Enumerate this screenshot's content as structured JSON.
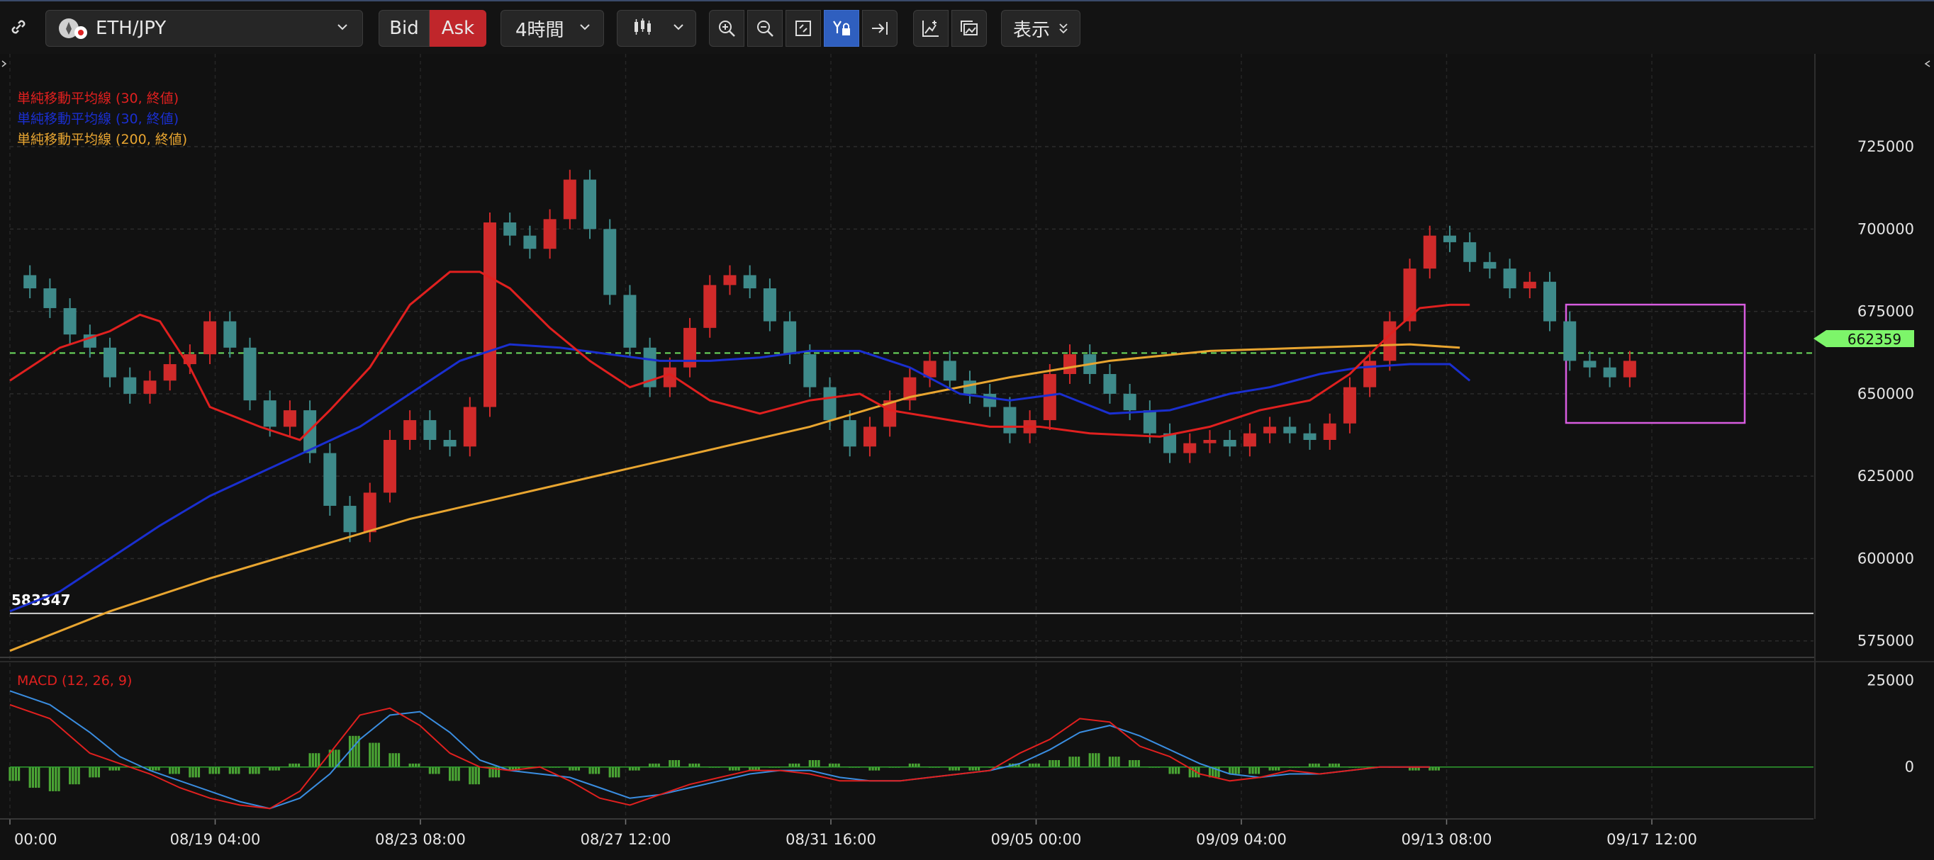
{
  "toolbar": {
    "symbol": "ETH/JPY",
    "bid_label": "Bid",
    "ask_label": "Ask",
    "timeframe": "4時間",
    "display_label": "表示"
  },
  "chart_data": {
    "type": "candlestick",
    "symbol": "ETH/JPY",
    "timeframe": "4時間",
    "indicators": [
      {
        "label": "単純移動平均線 (30, 終値)",
        "color": "#e0201f"
      },
      {
        "label": "単純移動平均線 (30, 終値)",
        "color": "#1a2fd0"
      },
      {
        "label": "単純移動平均線 (200, 終値)",
        "color": "#e8a530"
      }
    ],
    "macd": {
      "label": "MACD (12, 26, 9)",
      "color": "#e0201f"
    },
    "y_ticks": [
      575000,
      600000,
      625000,
      650000,
      675000,
      700000,
      725000
    ],
    "ylim": [
      570000,
      745000
    ],
    "macd_ticks": [
      "25000",
      "0"
    ],
    "x_ticks": [
      "00:00",
      "08/19 04:00",
      "08/23 08:00",
      "08/27 12:00",
      "08/31 16:00",
      "09/05 00:00",
      "09/09 04:00",
      "09/13 08:00",
      "09/17 12:00"
    ],
    "current_price": 662359,
    "current_price_label": "662359",
    "horizontal_line": 583347,
    "horizontal_line_label": "583347",
    "close_series": [
      [
        0,
        686000
      ],
      [
        4,
        682000
      ],
      [
        8,
        676000
      ],
      [
        12,
        668000
      ],
      [
        16,
        664000
      ],
      [
        20,
        655000
      ],
      [
        24,
        650000
      ],
      [
        28,
        654000
      ],
      [
        32,
        659000
      ],
      [
        36,
        662000
      ],
      [
        40,
        672000
      ],
      [
        44,
        664000
      ],
      [
        48,
        648000
      ],
      [
        52,
        640000
      ],
      [
        56,
        645000
      ],
      [
        60,
        632000
      ],
      [
        64,
        616000
      ],
      [
        68,
        608000
      ],
      [
        72,
        620000
      ],
      [
        76,
        636000
      ],
      [
        80,
        642000
      ],
      [
        84,
        636000
      ],
      [
        88,
        634000
      ],
      [
        92,
        646000
      ],
      [
        96,
        702000
      ],
      [
        100,
        698000
      ],
      [
        104,
        694000
      ],
      [
        108,
        703000
      ],
      [
        112,
        715000
      ],
      [
        116,
        700000
      ],
      [
        120,
        680000
      ],
      [
        124,
        664000
      ],
      [
        128,
        652000
      ],
      [
        132,
        658000
      ],
      [
        136,
        670000
      ],
      [
        140,
        683000
      ],
      [
        144,
        686000
      ],
      [
        148,
        682000
      ],
      [
        152,
        672000
      ],
      [
        156,
        662000
      ],
      [
        160,
        652000
      ],
      [
        164,
        642000
      ],
      [
        168,
        634000
      ],
      [
        172,
        640000
      ],
      [
        176,
        648000
      ],
      [
        180,
        655000
      ],
      [
        184,
        660000
      ],
      [
        188,
        654000
      ],
      [
        192,
        650000
      ],
      [
        196,
        646000
      ],
      [
        200,
        638000
      ],
      [
        204,
        642000
      ],
      [
        208,
        656000
      ],
      [
        212,
        662000
      ],
      [
        216,
        656000
      ],
      [
        220,
        650000
      ],
      [
        224,
        645000
      ],
      [
        228,
        638000
      ],
      [
        232,
        632000
      ],
      [
        236,
        635000
      ],
      [
        240,
        636000
      ],
      [
        244,
        634000
      ],
      [
        248,
        638000
      ],
      [
        252,
        640000
      ],
      [
        256,
        638000
      ],
      [
        260,
        636000
      ],
      [
        264,
        641000
      ],
      [
        268,
        652000
      ],
      [
        272,
        660000
      ],
      [
        276,
        672000
      ],
      [
        280,
        688000
      ],
      [
        284,
        698000
      ],
      [
        288,
        696000
      ],
      [
        292,
        690000
      ],
      [
        296,
        688000
      ],
      [
        300,
        682000
      ],
      [
        304,
        684000
      ],
      [
        308,
        672000
      ],
      [
        312,
        660000
      ],
      [
        316,
        658000
      ],
      [
        320,
        655000
      ],
      [
        324,
        660000
      ]
    ],
    "sma30_red": [
      [
        0,
        654000
      ],
      [
        10,
        664000
      ],
      [
        20,
        669000
      ],
      [
        26,
        674000
      ],
      [
        30,
        672000
      ],
      [
        36,
        658000
      ],
      [
        40,
        646000
      ],
      [
        50,
        640000
      ],
      [
        58,
        636000
      ],
      [
        64,
        645000
      ],
      [
        72,
        658000
      ],
      [
        80,
        677000
      ],
      [
        88,
        687000
      ],
      [
        94,
        687000
      ],
      [
        100,
        682000
      ],
      [
        108,
        670000
      ],
      [
        116,
        660000
      ],
      [
        124,
        652000
      ],
      [
        132,
        656000
      ],
      [
        140,
        648000
      ],
      [
        150,
        644000
      ],
      [
        160,
        648000
      ],
      [
        170,
        650000
      ],
      [
        176,
        645000
      ],
      [
        184,
        643000
      ],
      [
        196,
        640000
      ],
      [
        206,
        640000
      ],
      [
        216,
        638000
      ],
      [
        230,
        637000
      ],
      [
        240,
        640000
      ],
      [
        250,
        645000
      ],
      [
        260,
        648000
      ],
      [
        268,
        656000
      ],
      [
        276,
        668000
      ],
      [
        282,
        676000
      ],
      [
        288,
        677000
      ],
      [
        292,
        677000
      ]
    ],
    "sma30_blue": [
      [
        0,
        584000
      ],
      [
        10,
        590000
      ],
      [
        20,
        600000
      ],
      [
        30,
        610000
      ],
      [
        40,
        619000
      ],
      [
        50,
        626000
      ],
      [
        60,
        633000
      ],
      [
        70,
        640000
      ],
      [
        80,
        650000
      ],
      [
        90,
        660000
      ],
      [
        100,
        665000
      ],
      [
        110,
        664000
      ],
      [
        120,
        662000
      ],
      [
        130,
        660000
      ],
      [
        140,
        660000
      ],
      [
        150,
        661000
      ],
      [
        160,
        663000
      ],
      [
        170,
        663000
      ],
      [
        180,
        658000
      ],
      [
        190,
        650000
      ],
      [
        200,
        648000
      ],
      [
        210,
        650000
      ],
      [
        220,
        644000
      ],
      [
        232,
        645000
      ],
      [
        244,
        650000
      ],
      [
        252,
        652000
      ],
      [
        262,
        656000
      ],
      [
        270,
        658000
      ],
      [
        280,
        659000
      ],
      [
        288,
        659000
      ],
      [
        292,
        654000
      ]
    ],
    "sma200_yellow": [
      [
        0,
        572000
      ],
      [
        20,
        584000
      ],
      [
        40,
        594000
      ],
      [
        60,
        603000
      ],
      [
        80,
        612000
      ],
      [
        100,
        619000
      ],
      [
        120,
        626000
      ],
      [
        140,
        633000
      ],
      [
        160,
        640000
      ],
      [
        180,
        649000
      ],
      [
        200,
        655000
      ],
      [
        220,
        660000
      ],
      [
        240,
        663000
      ],
      [
        260,
        664000
      ],
      [
        280,
        665000
      ],
      [
        290,
        664000
      ]
    ],
    "macd_line_red": [
      [
        0,
        18000
      ],
      [
        8,
        14000
      ],
      [
        16,
        4000
      ],
      [
        22,
        1000
      ],
      [
        28,
        -2000
      ],
      [
        34,
        -6000
      ],
      [
        40,
        -9000
      ],
      [
        46,
        -11000
      ],
      [
        52,
        -12000
      ],
      [
        58,
        -7000
      ],
      [
        64,
        4000
      ],
      [
        70,
        15000
      ],
      [
        76,
        17000
      ],
      [
        82,
        12000
      ],
      [
        88,
        4000
      ],
      [
        94,
        0
      ],
      [
        100,
        -1000
      ],
      [
        106,
        0
      ],
      [
        112,
        -4000
      ],
      [
        118,
        -9000
      ],
      [
        124,
        -11000
      ],
      [
        130,
        -8000
      ],
      [
        136,
        -5000
      ],
      [
        142,
        -3000
      ],
      [
        148,
        -1000
      ],
      [
        154,
        -1000
      ],
      [
        160,
        -2000
      ],
      [
        166,
        -4000
      ],
      [
        172,
        -4000
      ],
      [
        178,
        -4000
      ],
      [
        184,
        -3000
      ],
      [
        190,
        -2000
      ],
      [
        196,
        -1000
      ],
      [
        202,
        4000
      ],
      [
        208,
        8000
      ],
      [
        214,
        14000
      ],
      [
        220,
        13000
      ],
      [
        226,
        6000
      ],
      [
        232,
        3000
      ],
      [
        238,
        -2000
      ],
      [
        244,
        -4000
      ],
      [
        250,
        -3000
      ],
      [
        256,
        -1000
      ],
      [
        262,
        -2000
      ],
      [
        268,
        -1000
      ],
      [
        274,
        0
      ],
      [
        280,
        0
      ],
      [
        284,
        0
      ]
    ],
    "macd_line_blue": [
      [
        0,
        22000
      ],
      [
        8,
        18000
      ],
      [
        16,
        10000
      ],
      [
        22,
        3000
      ],
      [
        28,
        -1000
      ],
      [
        34,
        -4000
      ],
      [
        40,
        -7000
      ],
      [
        46,
        -10000
      ],
      [
        52,
        -12000
      ],
      [
        58,
        -9000
      ],
      [
        64,
        -2000
      ],
      [
        70,
        8000
      ],
      [
        76,
        15000
      ],
      [
        82,
        16000
      ],
      [
        88,
        10000
      ],
      [
        94,
        2000
      ],
      [
        100,
        -1000
      ],
      [
        106,
        -2000
      ],
      [
        112,
        -3000
      ],
      [
        118,
        -6000
      ],
      [
        124,
        -9000
      ],
      [
        130,
        -8000
      ],
      [
        136,
        -6000
      ],
      [
        142,
        -4000
      ],
      [
        148,
        -2000
      ],
      [
        154,
        -1000
      ],
      [
        160,
        -1000
      ],
      [
        166,
        -3000
      ],
      [
        172,
        -4000
      ],
      [
        178,
        -4000
      ],
      [
        184,
        -3000
      ],
      [
        190,
        -2000
      ],
      [
        196,
        -1000
      ],
      [
        202,
        1000
      ],
      [
        208,
        5000
      ],
      [
        214,
        10000
      ],
      [
        220,
        12000
      ],
      [
        226,
        9000
      ],
      [
        232,
        5000
      ],
      [
        238,
        1000
      ],
      [
        244,
        -2000
      ],
      [
        250,
        -3000
      ],
      [
        256,
        -2000
      ],
      [
        262,
        -2000
      ],
      [
        268,
        -1000
      ],
      [
        274,
        0
      ],
      [
        280,
        0
      ],
      [
        284,
        0
      ]
    ],
    "macd_histogram": [
      [
        0,
        -4000
      ],
      [
        4,
        -6000
      ],
      [
        8,
        -7000
      ],
      [
        12,
        -5000
      ],
      [
        16,
        -3000
      ],
      [
        20,
        -1000
      ],
      [
        24,
        0
      ],
      [
        28,
        -1000
      ],
      [
        32,
        -2000
      ],
      [
        36,
        -3000
      ],
      [
        40,
        -2000
      ],
      [
        44,
        -2000
      ],
      [
        48,
        -2000
      ],
      [
        52,
        -1000
      ],
      [
        56,
        1000
      ],
      [
        60,
        4000
      ],
      [
        64,
        5000
      ],
      [
        68,
        9000
      ],
      [
        72,
        7000
      ],
      [
        76,
        4000
      ],
      [
        80,
        1000
      ],
      [
        84,
        -2000
      ],
      [
        88,
        -4000
      ],
      [
        92,
        -5000
      ],
      [
        96,
        -3000
      ],
      [
        100,
        -1000
      ],
      [
        104,
        0
      ],
      [
        108,
        0
      ],
      [
        112,
        -1000
      ],
      [
        116,
        -2000
      ],
      [
        120,
        -3000
      ],
      [
        124,
        -1000
      ],
      [
        128,
        1000
      ],
      [
        132,
        2000
      ],
      [
        136,
        1000
      ],
      [
        140,
        0
      ],
      [
        144,
        -1000
      ],
      [
        148,
        -1000
      ],
      [
        152,
        0
      ],
      [
        156,
        1000
      ],
      [
        160,
        2000
      ],
      [
        164,
        1000
      ],
      [
        168,
        0
      ],
      [
        172,
        -1000
      ],
      [
        176,
        0
      ],
      [
        180,
        1000
      ],
      [
        184,
        0
      ],
      [
        188,
        -1000
      ],
      [
        192,
        -1000
      ],
      [
        196,
        0
      ],
      [
        200,
        1000
      ],
      [
        204,
        1000
      ],
      [
        208,
        2000
      ],
      [
        212,
        3000
      ],
      [
        216,
        4000
      ],
      [
        220,
        3000
      ],
      [
        224,
        2000
      ],
      [
        228,
        0
      ],
      [
        232,
        -2000
      ],
      [
        236,
        -3000
      ],
      [
        240,
        -3000
      ],
      [
        244,
        -2000
      ],
      [
        248,
        -2000
      ],
      [
        252,
        -1000
      ],
      [
        256,
        0
      ],
      [
        260,
        1000
      ],
      [
        264,
        1000
      ],
      [
        268,
        0
      ],
      [
        272,
        0
      ],
      [
        276,
        0
      ],
      [
        280,
        -1000
      ],
      [
        284,
        -1000
      ]
    ],
    "macd_ylim": [
      -15000,
      28000
    ],
    "x_range": [
      0,
      330
    ]
  }
}
